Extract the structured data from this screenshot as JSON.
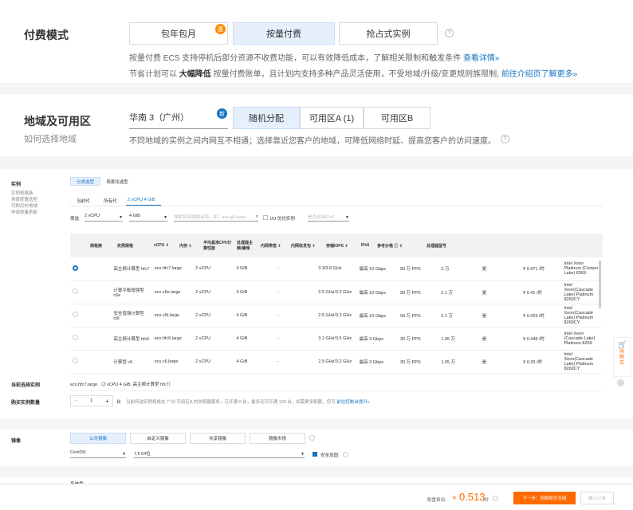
{
  "pay": {
    "title": "付费模式",
    "tabs": [
      "包年包月",
      "按量付费",
      "抢占式实例"
    ],
    "tab_badge": "惠",
    "desc1": "按量付费 ECS 支持停机后部分资源不收费功能，可以有效降低成本，了解相关限制和触发条件",
    "desc1_link": "查看详情»",
    "desc2_pre": "节省计划可以",
    "desc2_bold": "大幅降低",
    "desc2_mid": "按量付费账单，且计划内支持多种产品灵活使用，不受地域/升级/变更规则族限制,",
    "desc2_link": "前往介绍页了解更多»"
  },
  "region": {
    "title": "地域及可用区",
    "subtitle": "如何选择地域",
    "region_value": "华南 3（广州）",
    "new_badge": "新",
    "zones": [
      "随机分配",
      "可用区A (1)",
      "可用区B"
    ],
    "desc": "不同地域的实例之间内网互不相通；选择靠近您客户的地域，可降低网络时延、提高您客户的访问速度。"
  },
  "instance": {
    "label": "实例",
    "side_links": [
      "实例规格族",
      "场景配置选型",
      "可购买的地域",
      "申请放量系配"
    ],
    "type_tabs": [
      "分类选型",
      "场景化选型"
    ],
    "gen_tabs": [
      "当前代",
      "所有代",
      "2 vCPU 4 GiB"
    ],
    "filter_label": "筛选",
    "filter_cpu": "2 vCPU",
    "filter_mem": "4 GiB",
    "filter_search_placeholder": "搜索实例规格名称，如：ecs.g6.large",
    "io_label": "I/O 优化实例",
    "ipv6_placeholder": "是否支持IPv6",
    "columns": [
      "规格族",
      "实例规格",
      "vCPU ⇕",
      "内存 ⇕",
      "平均基准CPU计算性能",
      "处理器主频/睿频",
      "内网带宽 ⇕",
      "内网收发包 ⇕",
      "存储IOPS ⇕",
      "IPv6",
      "参考价格 ⓘ ⇕",
      "处理器型号"
    ],
    "rows": [
      {
        "family": "高主频计算型 hfc7",
        "spec": "ecs.hfc7.large",
        "vcpu": "2 vCPU",
        "mem": "4 GiB",
        "base": "-",
        "freq": "3.3/3.8 GHz",
        "bw": "最高 10 Gbps",
        "pps": "90 万 PPS",
        "iops": "2 万",
        "ipv6": "是",
        "price": "¥ 0.471 /时",
        "cpu": "Intel Xeon Platinum (Cooper Lake) 8369"
      },
      {
        "family": "计算平衡增强型 c6e",
        "spec": "ecs.c6e.large",
        "vcpu": "2 vCPU",
        "mem": "4 GiB",
        "base": "-",
        "freq": "2.5 GHz/3.2 GHz",
        "bw": "最高 10 Gbps",
        "pps": "90 万 PPS",
        "iops": "2.1 万",
        "ipv6": "是",
        "price": "¥ 0.41 /时",
        "cpu": "Intel Xeon(Cascade Lake) Platinum 8269CY"
      },
      {
        "family": "安全增强计算型 c6t",
        "spec": "ecs.c6t.large",
        "vcpu": "2 vCPU",
        "mem": "4 GiB",
        "base": "-",
        "freq": "2.5 GHz/3.2 GHz",
        "bw": "最高 10 Gbps",
        "pps": "90 万 PPS",
        "iops": "2.1 万",
        "ipv6": "是",
        "price": "¥ 0.423 /时",
        "cpu": "Intel Xeon(Cascade Lake) Platinum 8269CY"
      },
      {
        "family": "高主频计算型 hfc6",
        "spec": "ecs.hfc6.large",
        "vcpu": "2 vCPU",
        "mem": "4 GiB",
        "base": "-",
        "freq": "3.1 GHz/3.5 GHz",
        "bw": "最高 3 Gbps",
        "pps": "30 万 PPS",
        "iops": "1.05 万",
        "ipv6": "是",
        "price": "¥ 0.448 /时",
        "cpu": "Intel Xeon (Cascade Lake) Platinum 8269"
      },
      {
        "family": "计算型 c6",
        "spec": "ecs.c6.large",
        "vcpu": "2 vCPU",
        "mem": "4 GiB",
        "base": "-",
        "freq": "2.5 GHz/3.2 GHz",
        "bw": "最高 3 Gbps",
        "pps": "30 万 PPS",
        "iops": "1.05 万",
        "ipv6": "是",
        "price": "¥ 0.39 /时",
        "cpu": "Intel Xeon(Cascade Lake) Platinum 8269CY"
      }
    ],
    "current_label": "当前选择实例",
    "current_value": "ecs.hfc7.large （2 vCPU 4 GiB, 高主频计算型 hfc7）",
    "qty_label": "购买实例数量",
    "qty": "1",
    "qty_unit": "台",
    "qty_note": "当前所选实例规格在 广州 可用区A 的总配额服务，已开通 0 台，最多还可开通 128 台，如需更多配额，您可",
    "qty_link": "前往控制台提升»"
  },
  "image": {
    "label": "镜像",
    "tabs": [
      "公共镜像",
      "自定义镜像",
      "共享镜像",
      "镜像市场"
    ],
    "os": "CentOS",
    "version": "7.6 64位",
    "harden": "安全加固"
  },
  "next_label": "系统盘",
  "footer": {
    "fee_label": "配置费用:",
    "fee_prefix": "¥",
    "fee_value": "0.513",
    "fee_unit": "/时",
    "next_btn": "下一步：网络和安全组",
    "confirm_btn": "确认订单"
  },
  "cart": "购物车"
}
